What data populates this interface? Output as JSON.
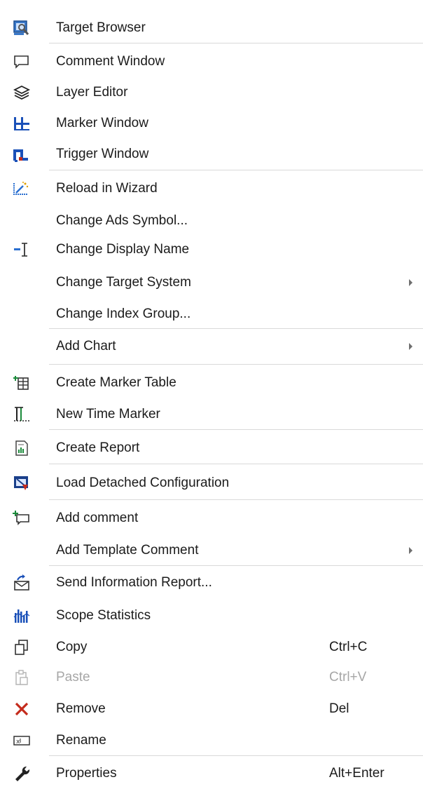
{
  "menu": {
    "items": [
      {
        "label": "Target Browser",
        "icon": "target-browser-icon"
      },
      {
        "label": "Comment Window",
        "icon": "comment-window-icon"
      },
      {
        "label": "Layer Editor",
        "icon": "layers-icon"
      },
      {
        "label": "Marker Window",
        "icon": "marker-window-icon"
      },
      {
        "label": "Trigger Window",
        "icon": "trigger-window-icon"
      },
      {
        "label": "Reload in Wizard",
        "icon": "wizard-icon"
      },
      {
        "label": "Change Ads Symbol...",
        "icon": ""
      },
      {
        "label": "Change Display Name",
        "icon": "display-name-icon"
      },
      {
        "label": "Change Target System",
        "icon": "",
        "submenu": true
      },
      {
        "label": "Change Index Group...",
        "icon": ""
      },
      {
        "label": "Add Chart",
        "icon": "",
        "submenu": true
      },
      {
        "label": "Create Marker Table",
        "icon": "marker-table-icon"
      },
      {
        "label": "New Time Marker",
        "icon": "time-marker-icon"
      },
      {
        "label": "Create Report",
        "icon": "report-icon"
      },
      {
        "label": "Load Detached Configuration",
        "icon": "detached-config-icon"
      },
      {
        "label": "Add comment",
        "icon": "add-comment-icon"
      },
      {
        "label": "Add Template Comment",
        "icon": "",
        "submenu": true
      },
      {
        "label": "Send Information Report...",
        "icon": "send-report-icon"
      },
      {
        "label": "Scope Statistics",
        "icon": "statistics-icon"
      },
      {
        "label": "Copy",
        "icon": "copy-icon",
        "shortcut": "Ctrl+C"
      },
      {
        "label": "Paste",
        "icon": "paste-icon",
        "shortcut": "Ctrl+V",
        "disabled": true
      },
      {
        "label": "Remove",
        "icon": "remove-icon",
        "shortcut": "Del"
      },
      {
        "label": "Rename",
        "icon": "rename-icon"
      },
      {
        "label": "Properties",
        "icon": "wrench-icon",
        "shortcut": "Alt+Enter"
      }
    ]
  },
  "colors": {
    "accent_blue": "#1f5fbf",
    "remove_red": "#c42b1c",
    "separator": "#d9d9d9",
    "disabled_text": "#a7a7a7"
  }
}
